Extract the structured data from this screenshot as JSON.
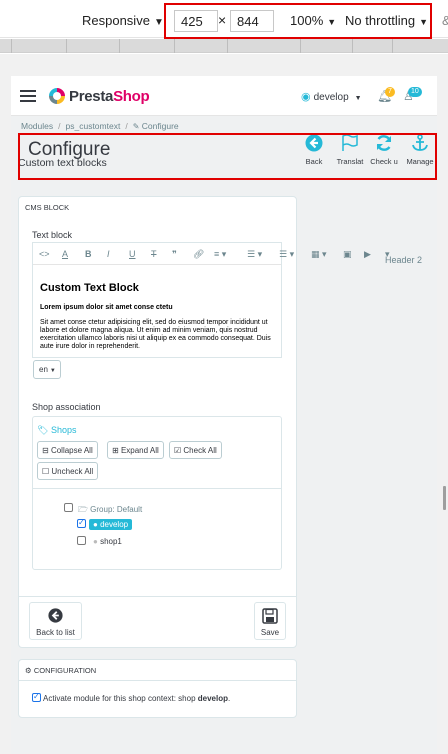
{
  "devtools": {
    "device": "Responsive",
    "width": "425",
    "height": "844",
    "times": "×",
    "zoom": "100%",
    "throttling": "No throttling",
    "edge_char": "&"
  },
  "header": {
    "logo_presta": "Presta",
    "logo_shop": "Shop",
    "shop_context": "develop",
    "notifications_orders": "7",
    "notifications_customers": "10"
  },
  "breadcrumb": {
    "items": [
      "Modules",
      "ps_customtext",
      "Configure"
    ]
  },
  "toolbar": {
    "title": "Configure",
    "subtitle": "Custom text blocks",
    "buttons": [
      "Back",
      "Translat",
      "Check u",
      "Manage"
    ]
  },
  "cms_panel": {
    "heading": "CMS BLOCK",
    "text_block_label": "Text block",
    "format_select": "Header 2",
    "content": {
      "heading": "Custom Text Block",
      "subheading": "Lorem ipsum dolor sit amet conse ctetu",
      "paragraph": "Sit amet conse ctetur adipisicing elit, sed do eiusmod tempor incididunt ut labore et dolore magna aliqua. Ut enim ad minim veniam, quis nostrud exercitation ullamco laboris nisi ut aliquip ex ea commodo consequat. Duis aute irure dolor in reprehenderit."
    },
    "language": "en",
    "shop_association_label": "Shop association",
    "shops_title": "Shops",
    "tree_buttons": [
      "Collapse All",
      "Expand All",
      "Check All",
      "Uncheck All"
    ],
    "tree": {
      "group": "Group: Default",
      "shops": [
        {
          "name": "develop",
          "checked": true
        },
        {
          "name": "shop1",
          "checked": false
        }
      ]
    },
    "back_button": "Back to list",
    "save_button": "Save"
  },
  "config_panel": {
    "heading": "CONFIGURATION",
    "activate_text": "Activate module for this shop context: shop",
    "activate_shop": "develop",
    "activate_end": "."
  },
  "colors": {
    "brand": "#df0067",
    "accent": "#25b9d7",
    "highlight": "#e00000"
  }
}
